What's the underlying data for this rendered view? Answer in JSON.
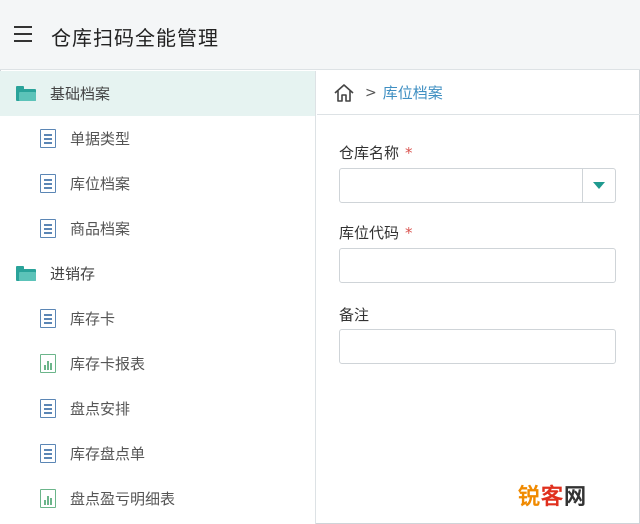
{
  "app": {
    "title": "仓库扫码全能管理"
  },
  "sidebar": {
    "groups": [
      {
        "label": "基础档案",
        "items": [
          {
            "label": "单据类型",
            "icon": "document-icon"
          },
          {
            "label": "库位档案",
            "icon": "document-icon"
          },
          {
            "label": "商品档案",
            "icon": "document-icon"
          }
        ]
      },
      {
        "label": "进销存",
        "items": [
          {
            "label": "库存卡",
            "icon": "document-icon"
          },
          {
            "label": "库存卡报表",
            "icon": "report-icon"
          },
          {
            "label": "盘点安排",
            "icon": "document-icon"
          },
          {
            "label": "库存盘点单",
            "icon": "document-icon"
          },
          {
            "label": "盘点盈亏明细表",
            "icon": "report-icon"
          }
        ]
      }
    ]
  },
  "breadcrumb": {
    "separator": ">",
    "current": "库位档案"
  },
  "form": {
    "warehouse_name": {
      "label": "仓库名称",
      "required": "*",
      "value": ""
    },
    "location_code": {
      "label": "库位代码",
      "required": "*",
      "value": "",
      "placeholder": ""
    },
    "remark": {
      "label": "备注",
      "value": "",
      "placeholder": ""
    }
  },
  "watermark": {
    "part1": "锐",
    "part2": "客",
    "part3": "网"
  },
  "colors": {
    "accent": "#2aa39a",
    "link": "#3f8fc2",
    "active_bg": "#e6f3f1",
    "required": "#d9534f"
  }
}
